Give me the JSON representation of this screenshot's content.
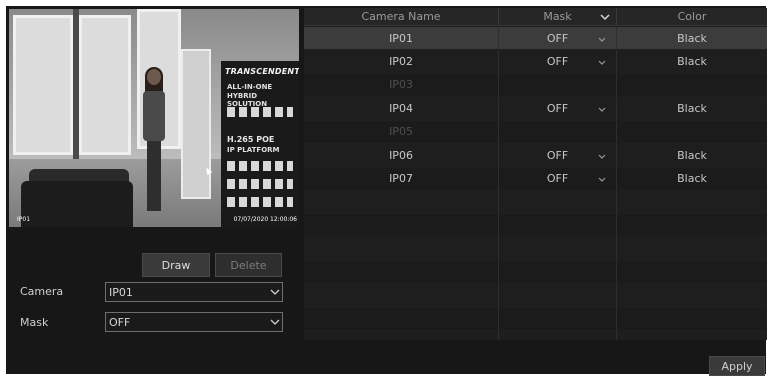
{
  "preview": {
    "camera_label": "IP01",
    "timestamp": "07/07/2020 12:00:06",
    "poster_brand": "TRANSCENDENT",
    "poster_line1": "ALL-IN-ONE",
    "poster_line2": "HYBRID SOLUTION",
    "poster_line3": "H.265 POE",
    "poster_line4": "IP PLATFORM"
  },
  "controls": {
    "draw_label": "Draw",
    "delete_label": "Delete",
    "camera_label": "Camera",
    "camera_value": "IP01",
    "mask_label": "Mask",
    "mask_value": "OFF"
  },
  "table": {
    "columns": {
      "name": "Camera Name",
      "mask": "Mask",
      "color": "Color"
    },
    "rows": [
      {
        "name": "IP01",
        "mask": "OFF",
        "color": "Black",
        "enabled": true,
        "selected": true
      },
      {
        "name": "IP02",
        "mask": "OFF",
        "color": "Black",
        "enabled": true,
        "selected": false
      },
      {
        "name": "IP03",
        "mask": "",
        "color": "",
        "enabled": false,
        "selected": false
      },
      {
        "name": "IP04",
        "mask": "OFF",
        "color": "Black",
        "enabled": true,
        "selected": false
      },
      {
        "name": "IP05",
        "mask": "",
        "color": "",
        "enabled": false,
        "selected": false
      },
      {
        "name": "IP06",
        "mask": "OFF",
        "color": "Black",
        "enabled": true,
        "selected": false
      },
      {
        "name": "IP07",
        "mask": "OFF",
        "color": "Black",
        "enabled": true,
        "selected": false
      },
      {
        "name": "",
        "mask": "",
        "color": "",
        "enabled": false,
        "selected": false
      },
      {
        "name": "",
        "mask": "",
        "color": "",
        "enabled": false,
        "selected": false
      },
      {
        "name": "",
        "mask": "",
        "color": "",
        "enabled": false,
        "selected": false
      },
      {
        "name": "",
        "mask": "",
        "color": "",
        "enabled": false,
        "selected": false
      },
      {
        "name": "",
        "mask": "",
        "color": "",
        "enabled": false,
        "selected": false
      },
      {
        "name": "",
        "mask": "",
        "color": "",
        "enabled": false,
        "selected": false
      },
      {
        "name": "",
        "mask": "",
        "color": "",
        "enabled": false,
        "selected": false
      }
    ]
  },
  "apply_label": "Apply"
}
